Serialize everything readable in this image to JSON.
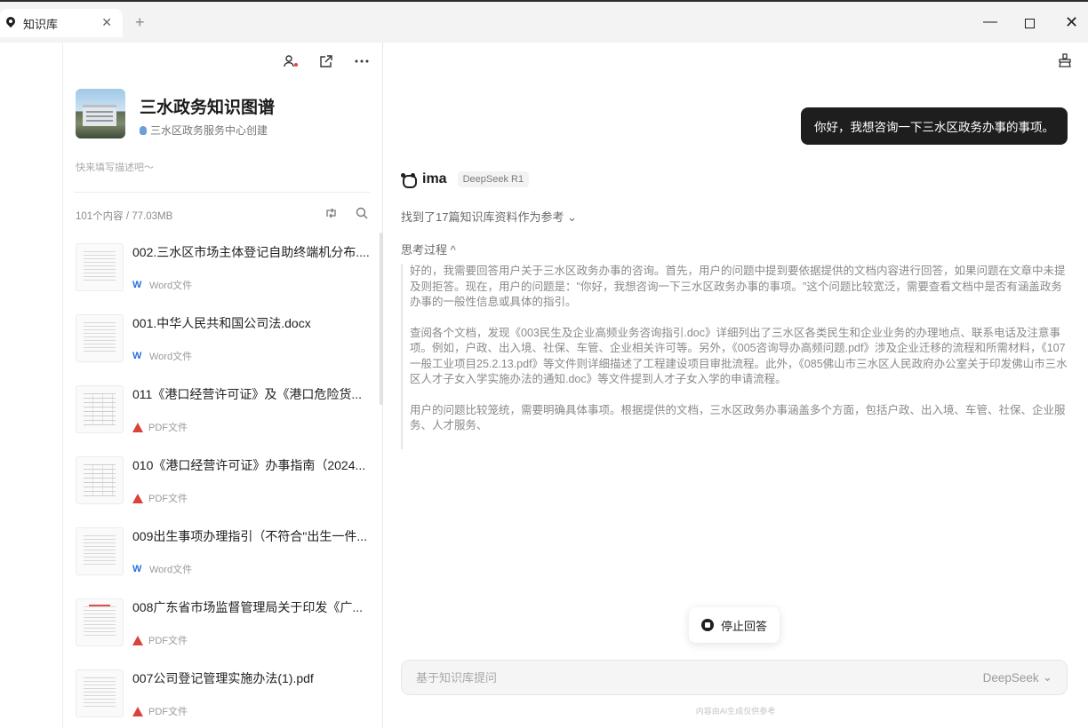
{
  "window": {
    "tab_title": "知识库",
    "tab_close": "✕",
    "new_tab": "+",
    "min": "—",
    "close": "✕"
  },
  "left": {
    "kb_title": "三水政务知识图谱",
    "kb_owner": "三水区政务服务中心创建",
    "kb_desc": "快来填写描述吧～",
    "count": "101个内容 / 77.03MB",
    "docs": [
      {
        "title": "002.三水区市场主体登记自助终端机分布....",
        "type": "Word文件",
        "kind": "word"
      },
      {
        "title": "001.中华人民共和国公司法.docx",
        "type": "Word文件",
        "kind": "word"
      },
      {
        "title": "011《港口经营许可证》及《港口危险货...",
        "type": "PDF文件",
        "kind": "pdf"
      },
      {
        "title": "010《港口经营许可证》办事指南（2024...",
        "type": "PDF文件",
        "kind": "pdf"
      },
      {
        "title": "009出生事项办理指引（不符合\"出生一件...",
        "type": "Word文件",
        "kind": "word"
      },
      {
        "title": "008广东省市场监督管理局关于印发《广...",
        "type": "PDF文件",
        "kind": "pdf"
      },
      {
        "title": "007公司登记管理实施办法(1).pdf",
        "type": "PDF文件",
        "kind": "pdf"
      }
    ],
    "badge_word": "W"
  },
  "chat": {
    "user_message": "你好，我想咨询一下三水区政务办事的事项。",
    "ai_name": "ima",
    "model_tag": "DeepSeek R1",
    "refs": "找到了17篇知识库资料作为参考",
    "refs_chevron": "⌄",
    "think_label": "思考过程",
    "think_chevron": "^",
    "thinking": [
      "好的，我需要回答用户关于三水区政务办事的咨询。首先，用户的问题中提到要依据提供的文档内容进行回答，如果问题在文章中未提及则拒答。现在，用户的问题是：\"你好，我想咨询一下三水区政务办事的事项。\"这个问题比较宽泛，需要查看文档中是否有涵盖政务办事的一般性信息或具体的指引。",
      "查阅各个文档，发现《003民生及企业高频业务咨询指引.doc》详细列出了三水区各类民生和企业业务的办理地点、联系电话及注意事项。例如，户政、出入境、社保、车管、企业相关许可等。另外，《005咨询导办高频问题.pdf》涉及企业迁移的流程和所需材料，《107一般工业项目25.2.13.pdf》等文件则详细描述了工程建设项目审批流程。此外，《085佛山市三水区人民政府办公室关于印发佛山市三水区人才子女入学实施办法的通知.doc》等文件提到人才子女入学的申请流程。",
      "用户的问题比较笼统，需要明确具体事项。根据提供的文档，三水区政务办事涵盖多个方面，包括户政、出入境、车管、社保、企业服务、人才服务、"
    ],
    "stop_label": "停止回答",
    "input_placeholder": "基于知识库提问",
    "model_select": "DeepSeek",
    "model_chevron": "⌄",
    "footnote": "内容由AI生成仅供参考"
  }
}
